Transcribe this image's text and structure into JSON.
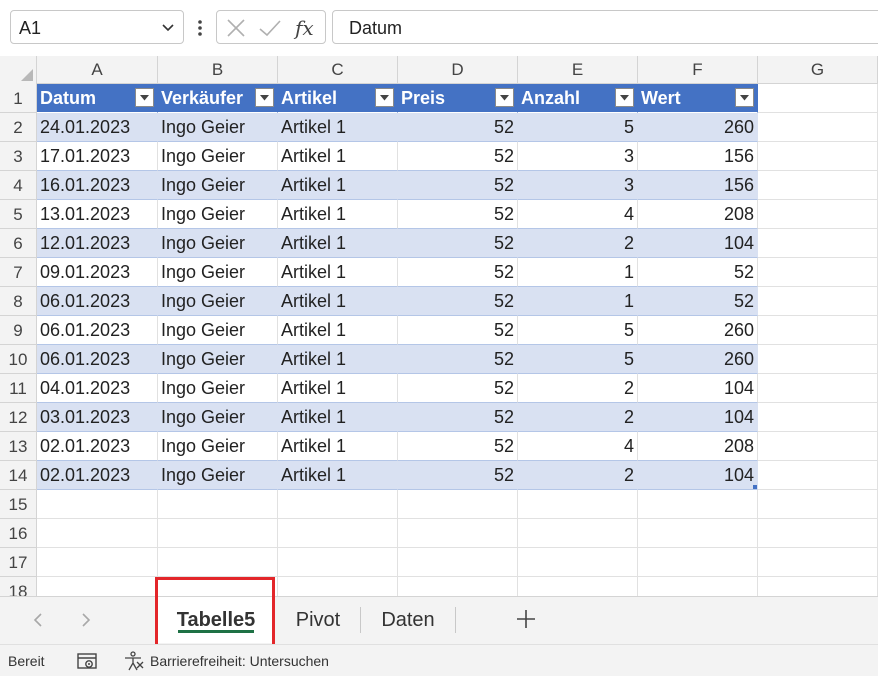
{
  "name_box": {
    "value": "A1"
  },
  "formula_bar": {
    "value": "Datum"
  },
  "columns": [
    "A",
    "B",
    "C",
    "D",
    "E",
    "F",
    "G"
  ],
  "table_headers": [
    "Datum",
    "Verkäufer",
    "Artikel",
    "Preis",
    "Anzahl",
    "Wert"
  ],
  "rows": [
    [
      "24.01.2023",
      "Ingo Geier",
      "Artikel 1",
      "52",
      "5",
      "260"
    ],
    [
      "17.01.2023",
      "Ingo Geier",
      "Artikel 1",
      "52",
      "3",
      "156"
    ],
    [
      "16.01.2023",
      "Ingo Geier",
      "Artikel 1",
      "52",
      "3",
      "156"
    ],
    [
      "13.01.2023",
      "Ingo Geier",
      "Artikel 1",
      "52",
      "4",
      "208"
    ],
    [
      "12.01.2023",
      "Ingo Geier",
      "Artikel 1",
      "52",
      "2",
      "104"
    ],
    [
      "09.01.2023",
      "Ingo Geier",
      "Artikel 1",
      "52",
      "1",
      "52"
    ],
    [
      "06.01.2023",
      "Ingo Geier",
      "Artikel 1",
      "52",
      "1",
      "52"
    ],
    [
      "06.01.2023",
      "Ingo Geier",
      "Artikel 1",
      "52",
      "5",
      "260"
    ],
    [
      "06.01.2023",
      "Ingo Geier",
      "Artikel 1",
      "52",
      "5",
      "260"
    ],
    [
      "04.01.2023",
      "Ingo Geier",
      "Artikel 1",
      "52",
      "2",
      "104"
    ],
    [
      "03.01.2023",
      "Ingo Geier",
      "Artikel 1",
      "52",
      "2",
      "104"
    ],
    [
      "02.01.2023",
      "Ingo Geier",
      "Artikel 1",
      "52",
      "4",
      "208"
    ],
    [
      "02.01.2023",
      "Ingo Geier",
      "Artikel 1",
      "52",
      "2",
      "104"
    ]
  ],
  "row_numbers": [
    "1",
    "2",
    "3",
    "4",
    "5",
    "6",
    "7",
    "8",
    "9",
    "10",
    "11",
    "12",
    "13",
    "14",
    "15",
    "16",
    "17",
    "18"
  ],
  "sheet_tabs": [
    {
      "label": "Tabelle5",
      "active": true
    },
    {
      "label": "Pivot",
      "active": false
    },
    {
      "label": "Daten",
      "active": false
    }
  ],
  "status": {
    "ready": "Bereit",
    "accessibility": "Barrierefreiheit: Untersuchen"
  },
  "colors": {
    "table_header": "#4472c4",
    "band": "#d9e1f2",
    "active_tab_underline": "#1e7145",
    "highlight": "#e3262a"
  },
  "icons": [
    "chevron-down-icon",
    "more-vertical-icon",
    "cancel-x-icon",
    "confirm-check-icon",
    "function-fx-icon",
    "filter-dropdown-icon",
    "chevron-left-icon",
    "chevron-right-icon",
    "plus-icon",
    "macro-record-icon",
    "accessibility-icon"
  ]
}
